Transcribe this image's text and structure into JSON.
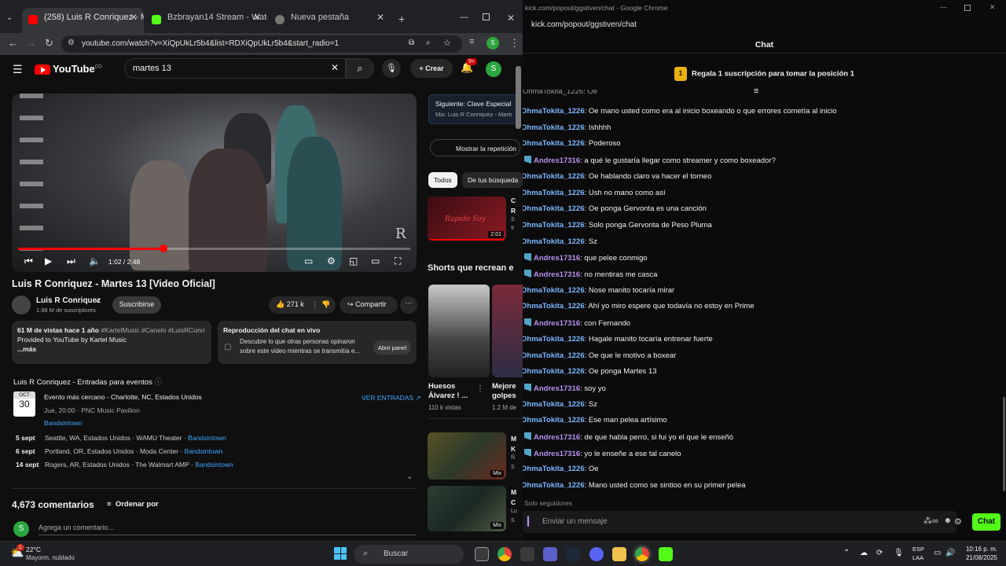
{
  "left_browser": {
    "tabs": [
      {
        "label": "(258) Luis R Conriquez - Martes"
      },
      {
        "label": "Bzbrayan14 Stream - Watch Liv"
      },
      {
        "label": "Nueva pestaña"
      }
    ],
    "url": "youtube.com/watch?v=XiQpUkLr5b4&list=RDXiQpUkLr5b4&start_radio=1",
    "youtube": {
      "logo": "YouTube",
      "logo_sup": "CO",
      "search_value": "martes 13",
      "create_label": "Crear",
      "notif_count": "9+",
      "avatar_letter": "S",
      "video_time": "1:02 / 2:48",
      "progress": 0.37,
      "watermark": "R",
      "title": "Luis R Conriquez - Martes 13 [Video Oficial]",
      "channel": "Luis R Conriquez",
      "subscribers": "1.98 M de suscriptores",
      "subscribe_label": "Suscribirse",
      "likes": "271 k",
      "share_label": "Compartir",
      "desc_stats": "61 M de vistas  hace 1 año",
      "desc_tags": "#KartelMusic #Canelo #LuisRConri",
      "desc_line2": "Provided to YouTube by Kartel Music",
      "desc_more": "...más",
      "chat_replay_title": "Reproducción del chat en vivo",
      "chat_replay_text1": "Descubre lo que otras personas opinaron",
      "chat_replay_text2": "sobre este video mientras se transmitía e...",
      "chat_replay_btn": "Abrir panel",
      "events_heading": "Luis R Conriquez - Entradas para eventos",
      "event_month": "OCT",
      "event_day": "30",
      "event_title": "Evento más cercano - Charlotte, NC, Estados Unidos",
      "event_time": "Jue, 20:00 · PNC Music Pavilion",
      "event_provider": "Bandsintown",
      "event_tickets": "VER ENTRADAS",
      "more_events": [
        {
          "date": "5 sept",
          "place": "Seattle, WA, Estados Unidos · WAMU Theater ·",
          "provider": "Bandsintown"
        },
        {
          "date": "6 sept",
          "place": "Portland, OR, Estados Unidos · Moda Center ·",
          "provider": "Bandsintown"
        },
        {
          "date": "14 sept",
          "place": "Rogers, AR, Estados Unidos · The Walmart AMP ·",
          "provider": "Bandsintown"
        }
      ],
      "comments_count": "4,673 comentarios",
      "sort_label": "Ordenar por",
      "comment_placeholder": "Agrega un comentario...",
      "sidebar": {
        "up_next_label": "Siguiente: Clave Especial -",
        "up_next_sub": "Mix: Luis R Conriquez - Martes",
        "replay_btn": "Mostrar la repetición",
        "chip_all": "Todos",
        "chip_searches": "De tus búsqueda",
        "rec1_thumb_text": "Rapido Soy",
        "rec1_duration": "2:01",
        "rec1_title_frag": "C",
        "rec1_title_frag2": "R",
        "rec1_meta_frag": "S",
        "rec1_meta_frag2": "9",
        "shorts_heading": "Shorts que recrean e",
        "short1_title": "Huesos Álvarez ! ...",
        "short1_views": "110 k vistas",
        "short2_title": "Mejore golpes",
        "short2_views": "1.2 M de",
        "mix_label": "Mix",
        "rec2_frag": "M",
        "rec2_frag2": "K",
        "rec2_frag3": "Ñ",
        "rec2_frag4": "S",
        "rec3_frag": "M",
        "rec3_frag2": "C",
        "rec3_frag3": "Lu",
        "rec3_frag4": "S"
      }
    }
  },
  "right_browser": {
    "window_title": "kick.com/popout/ggstiven/chat - Google Chrome",
    "url": "kick.com/popout/ggstiven/chat",
    "header": "Chat",
    "gift_badge": "1",
    "gift_text": "Regala 1 suscripción para tomar la posición 1",
    "partial_top": "OhmaTokita_1226: Oe",
    "messages": [
      {
        "user": "OhmaTokita_1226",
        "text": "Oe mano usted como era al inicio boxeando o que errores cometía al inicio",
        "badge": false
      },
      {
        "user": "OhmaTokita_1226",
        "text": "Ishhhh",
        "badge": false
      },
      {
        "user": "OhmaTokita_1226",
        "text": "Poderoso",
        "badge": false
      },
      {
        "user": "Andres17316",
        "text": "a qué le gustaría llegar como streamer y como boxeador?",
        "badge": true
      },
      {
        "user": "OhmaTokita_1226",
        "text": "Oe hablando claro va hacer el torneo",
        "badge": false
      },
      {
        "user": "OhmaTokita_1226",
        "text": "Ush no mano como así",
        "badge": false
      },
      {
        "user": "OhmaTokita_1226",
        "text": "Oe ponga Gervonta es una canción",
        "badge": false
      },
      {
        "user": "OhmaTokita_1226",
        "text": "Solo ponga Gervonta de Peso Pluma",
        "badge": false
      },
      {
        "user": "OhmaTokita_1226",
        "text": "Sz",
        "badge": false
      },
      {
        "user": "Andres17316",
        "text": "que pelee conmigo",
        "badge": true
      },
      {
        "user": "Andres17316",
        "text": "no mentiras me casca",
        "badge": true
      },
      {
        "user": "OhmaTokita_1226",
        "text": "Nose manito tocaría mirar",
        "badge": false
      },
      {
        "user": "OhmaTokita_1226",
        "text": "Ahí yo miro espere que todavía no estoy en Prime",
        "badge": false
      },
      {
        "user": "Andres17316",
        "text": "con Fernando",
        "badge": true
      },
      {
        "user": "OhmaTokita_1226",
        "text": "Hagale manito tocaría entrenar fuerte",
        "badge": false
      },
      {
        "user": "OhmaTokita_1226",
        "text": "Oe que le motivo a boxear",
        "badge": false
      },
      {
        "user": "OhmaTokita_1226",
        "text": "Oe ponga Martes 13",
        "badge": false
      },
      {
        "user": "Andres17316",
        "text": "soy yo",
        "badge": true
      },
      {
        "user": "OhmaTokita_1226",
        "text": "Sz",
        "badge": false
      },
      {
        "user": "OhmaTokita_1226",
        "text": "Ese man pelea artísimo",
        "badge": false
      },
      {
        "user": "Andres17316",
        "text": "de que habla perro, si fui yo el que le enseñó",
        "badge": true
      },
      {
        "user": "Andres17316",
        "text": "yo le enseñe a ese tal canelo",
        "badge": true
      },
      {
        "user": "OhmaTokita_1226",
        "text": "Oe",
        "badge": false
      },
      {
        "user": "OhmaTokita_1226",
        "text": "Mano usted como se sintioo en su primer pelea",
        "badge": false
      }
    ],
    "followers_only": "Solo seguidores",
    "input_placeholder": "Enviar un mensaje",
    "chat_button": "Chat",
    "colors": {
      "ohma": "#7ab8ff",
      "andres": "#b792f0",
      "accent": "#53fc18"
    }
  },
  "taskbar": {
    "weather_temp": "22°C",
    "weather_desc": "Mayorm. nublado",
    "weather_badge": "1",
    "search_label": "Buscar",
    "lang1": "ESP",
    "lang2": "LAA",
    "time": "10:16 p. m.",
    "date": "21/08/2025"
  }
}
